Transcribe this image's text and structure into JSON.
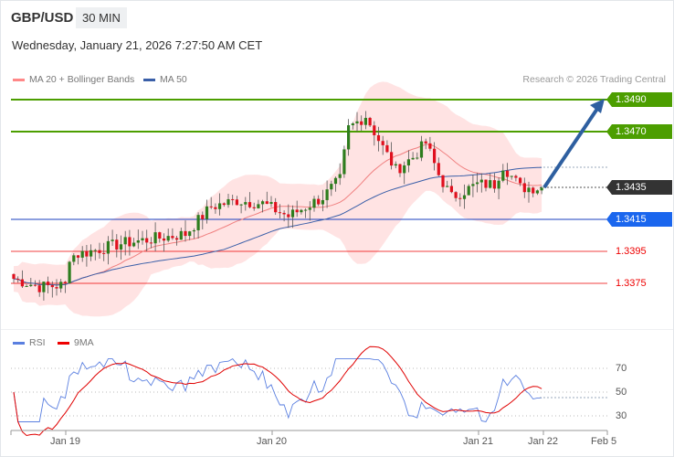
{
  "header": {
    "symbol": "GBP/USD",
    "timeframe": "30 MIN",
    "datetime": "Wednesday, January 21, 2026 7:27:50 AM CET"
  },
  "legend": {
    "ma20": "MA 20 + Bollinger Bands",
    "ma50": "MA 50",
    "rsi": "RSI",
    "ma9": "9MA"
  },
  "credit": "Research © 2026 Trading Central",
  "levels": [
    {
      "price": "1.3490",
      "type": "resistance",
      "color": "#4c9e00"
    },
    {
      "price": "1.3470",
      "type": "resistance",
      "color": "#4c9e00"
    },
    {
      "price": "1.3435",
      "type": "last",
      "color": "#333333"
    },
    {
      "price": "1.3415",
      "type": "pivot",
      "color": "#1a66ee"
    },
    {
      "price": "1.3395",
      "type": "support",
      "color": "#e00000"
    },
    {
      "price": "1.3375",
      "type": "support",
      "color": "#e00000"
    }
  ],
  "rsi_axis": [
    "70",
    "50",
    "30"
  ],
  "x_axis": [
    "Jan 19",
    "Jan 20",
    "Jan 21",
    "Jan 22",
    "Feb 5"
  ],
  "chart_data": {
    "type": "candlestick",
    "price_path_keyframes": [
      [
        0,
        1.3378
      ],
      [
        6,
        1.3373
      ],
      [
        12,
        1.3374
      ],
      [
        13,
        1.3392
      ],
      [
        25,
        1.34
      ],
      [
        40,
        1.3406
      ],
      [
        46,
        1.3423
      ],
      [
        52,
        1.3427
      ],
      [
        58,
        1.3425
      ],
      [
        64,
        1.3417
      ],
      [
        72,
        1.3429
      ],
      [
        76,
        1.344
      ],
      [
        78,
        1.3472
      ],
      [
        82,
        1.348
      ],
      [
        86,
        1.346
      ],
      [
        89,
        1.3446
      ],
      [
        93,
        1.3454
      ],
      [
        96,
        1.3463
      ],
      [
        99,
        1.3443
      ],
      [
        102,
        1.3429
      ],
      [
        108,
        1.3437
      ],
      [
        112,
        1.3437
      ],
      [
        114,
        1.3449
      ],
      [
        118,
        1.3435
      ],
      [
        123,
        1.3435
      ]
    ],
    "forecast_target": 1.349
  },
  "colors": {
    "up": "#2e7d1e",
    "down": "#e0101e",
    "ma20": "#f08080",
    "ma50": "#3a5fa8",
    "band": "#ffdcdc",
    "rsi": "#5a7fe0",
    "ma9": "#e00000",
    "arrow": "#2e5fa0"
  }
}
